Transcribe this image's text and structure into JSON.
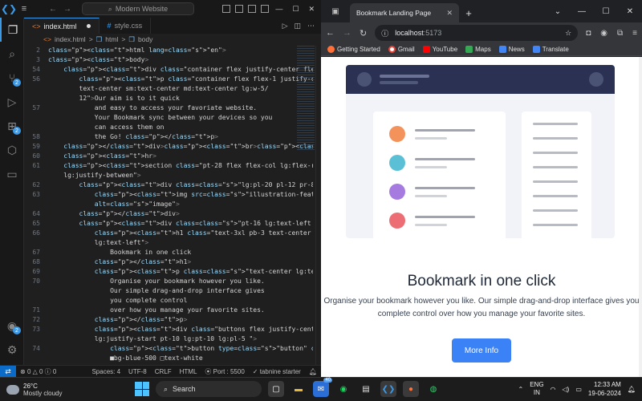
{
  "vscode": {
    "search_text": "Modern Website",
    "tabs": [
      {
        "label": "index.html",
        "icon": "html-icon"
      },
      {
        "label": "style.css",
        "icon": "css-icon"
      }
    ],
    "breadcrumb": [
      "index.html",
      ">",
      "html",
      ">",
      "body"
    ],
    "activity_badges": {
      "source_control": "2",
      "extensions": "2"
    },
    "lines": [
      {
        "n": "2",
        "code": "<html lang=\"en\">"
      },
      {
        "n": "3",
        "code": "<body>"
      },
      {
        "n": "54",
        "code": "    <div class=\"container flex justify-center flex-col"
      },
      {
        "n": "56",
        "code": "        <p class=\"container flex flex-1 justify-center"
      },
      {
        "n": "",
        "code": "        text-center sm:text-center md:text-center lg:w-5/"
      },
      {
        "n": "",
        "code": "        12\">Our aim is to it quick"
      },
      {
        "n": "57",
        "code": "            and easy to access your favoriate website."
      },
      {
        "n": "",
        "code": "            Your Bookmark sync between your devices so you"
      },
      {
        "n": "",
        "code": "            can access them on"
      },
      {
        "n": "58",
        "code": "            the Go! </p>"
      },
      {
        "n": "59",
        "code": "    </div><br><br><br>"
      },
      {
        "n": "60",
        "code": "    <hr>"
      },
      {
        "n": "61",
        "code": "    <section class=\"pt-28 flex flex-col lg:flex-row"
      },
      {
        "n": "",
        "code": "    lg:justify-between\">"
      },
      {
        "n": "62",
        "code": "        <div class=\"lg:pl-20 pl-12 pr-8\">"
      },
      {
        "n": "63",
        "code": "            <img src=\"illustration-features-tab-1.png\""
      },
      {
        "n": "",
        "code": "            alt=\"image\">"
      },
      {
        "n": "64",
        "code": "        </div>"
      },
      {
        "n": "65",
        "code": "        <div class=\"pt-16 lg:text-left lg:pl-5 lg:w-1/2\">"
      },
      {
        "n": "66",
        "code": "            <h1 class=\"text-3xl pb-3 text-center"
      },
      {
        "n": "",
        "code": "            lg:text-left\">"
      },
      {
        "n": "67",
        "code": "                Bookmark in one click"
      },
      {
        "n": "68",
        "code": "            </h1>"
      },
      {
        "n": "69",
        "code": "            <p class=\"text-center lg:text-left lg:w-3/4\">"
      },
      {
        "n": "70",
        "code": "                Organise your bookmark however you like."
      },
      {
        "n": "",
        "code": "                Our simple drag-and-drop interface gives"
      },
      {
        "n": "",
        "code": "                you complete control"
      },
      {
        "n": "71",
        "code": "                over how you manage your favorite sites."
      },
      {
        "n": "72",
        "code": "            </p>"
      },
      {
        "n": "73",
        "code": "            <div class=\"buttons flex justify-center"
      },
      {
        "n": "",
        "code": "            lg:justify-start pt-10 lg:pt-10 lg:pl-5 \">"
      },
      {
        "n": "74",
        "code": "                <button type=\"button\" class=\"btn"
      },
      {
        "n": "",
        "code": "                ■bg-blue-500 □text-white"
      }
    ],
    "status": {
      "errors": "0",
      "warnings": "0",
      "info": "0",
      "spaces": "Spaces: 4",
      "encoding": "UTF-8",
      "eol": "CRLF",
      "language": "HTML",
      "port": "Port : 5500",
      "tabnine": "tabnine starter"
    }
  },
  "browser": {
    "tab_title": "Bookmark Landing Page",
    "url_host": "localhost",
    "url_port": ":5173",
    "bookmarks": [
      {
        "label": "Getting Started",
        "color": "#ff7139"
      },
      {
        "label": "Gmail",
        "color": "#ea4335"
      },
      {
        "label": "YouTube",
        "color": "#ff0000"
      },
      {
        "label": "Maps",
        "color": "#34a853"
      },
      {
        "label": "News",
        "color": "#4285f4"
      },
      {
        "label": "Translate",
        "color": "#4285f4"
      }
    ],
    "page": {
      "title": "Bookmark in one click",
      "text_line1": "Organise your bookmark however you like. Our simple drag-and-drop interface gives you",
      "text_line2": "complete control over how you manage your favorite sites.",
      "button": "More Info",
      "bullet_colors": [
        "#f4925b",
        "#5bc0d6",
        "#a67be0",
        "#ec6d74"
      ]
    }
  },
  "taskbar": {
    "temperature": "26°C",
    "weather": "Mostly cloudy",
    "search": "Search",
    "lang": "ENG",
    "region": "IN",
    "time": "12:33 AM",
    "date": "19-06-2024",
    "notify_badge": "40"
  }
}
